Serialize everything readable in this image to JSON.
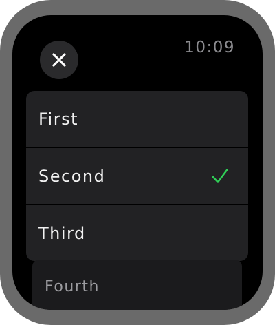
{
  "status": {
    "time": "10:09"
  },
  "controls": {
    "close_icon": "close-icon"
  },
  "list": {
    "items": [
      {
        "label": "First",
        "selected": false
      },
      {
        "label": "Second",
        "selected": true
      },
      {
        "label": "Third",
        "selected": false
      },
      {
        "label": "Fourth",
        "selected": false
      }
    ]
  },
  "colors": {
    "accent": "#30d158",
    "row_background": "#222224",
    "case": "#6a6a6a"
  }
}
